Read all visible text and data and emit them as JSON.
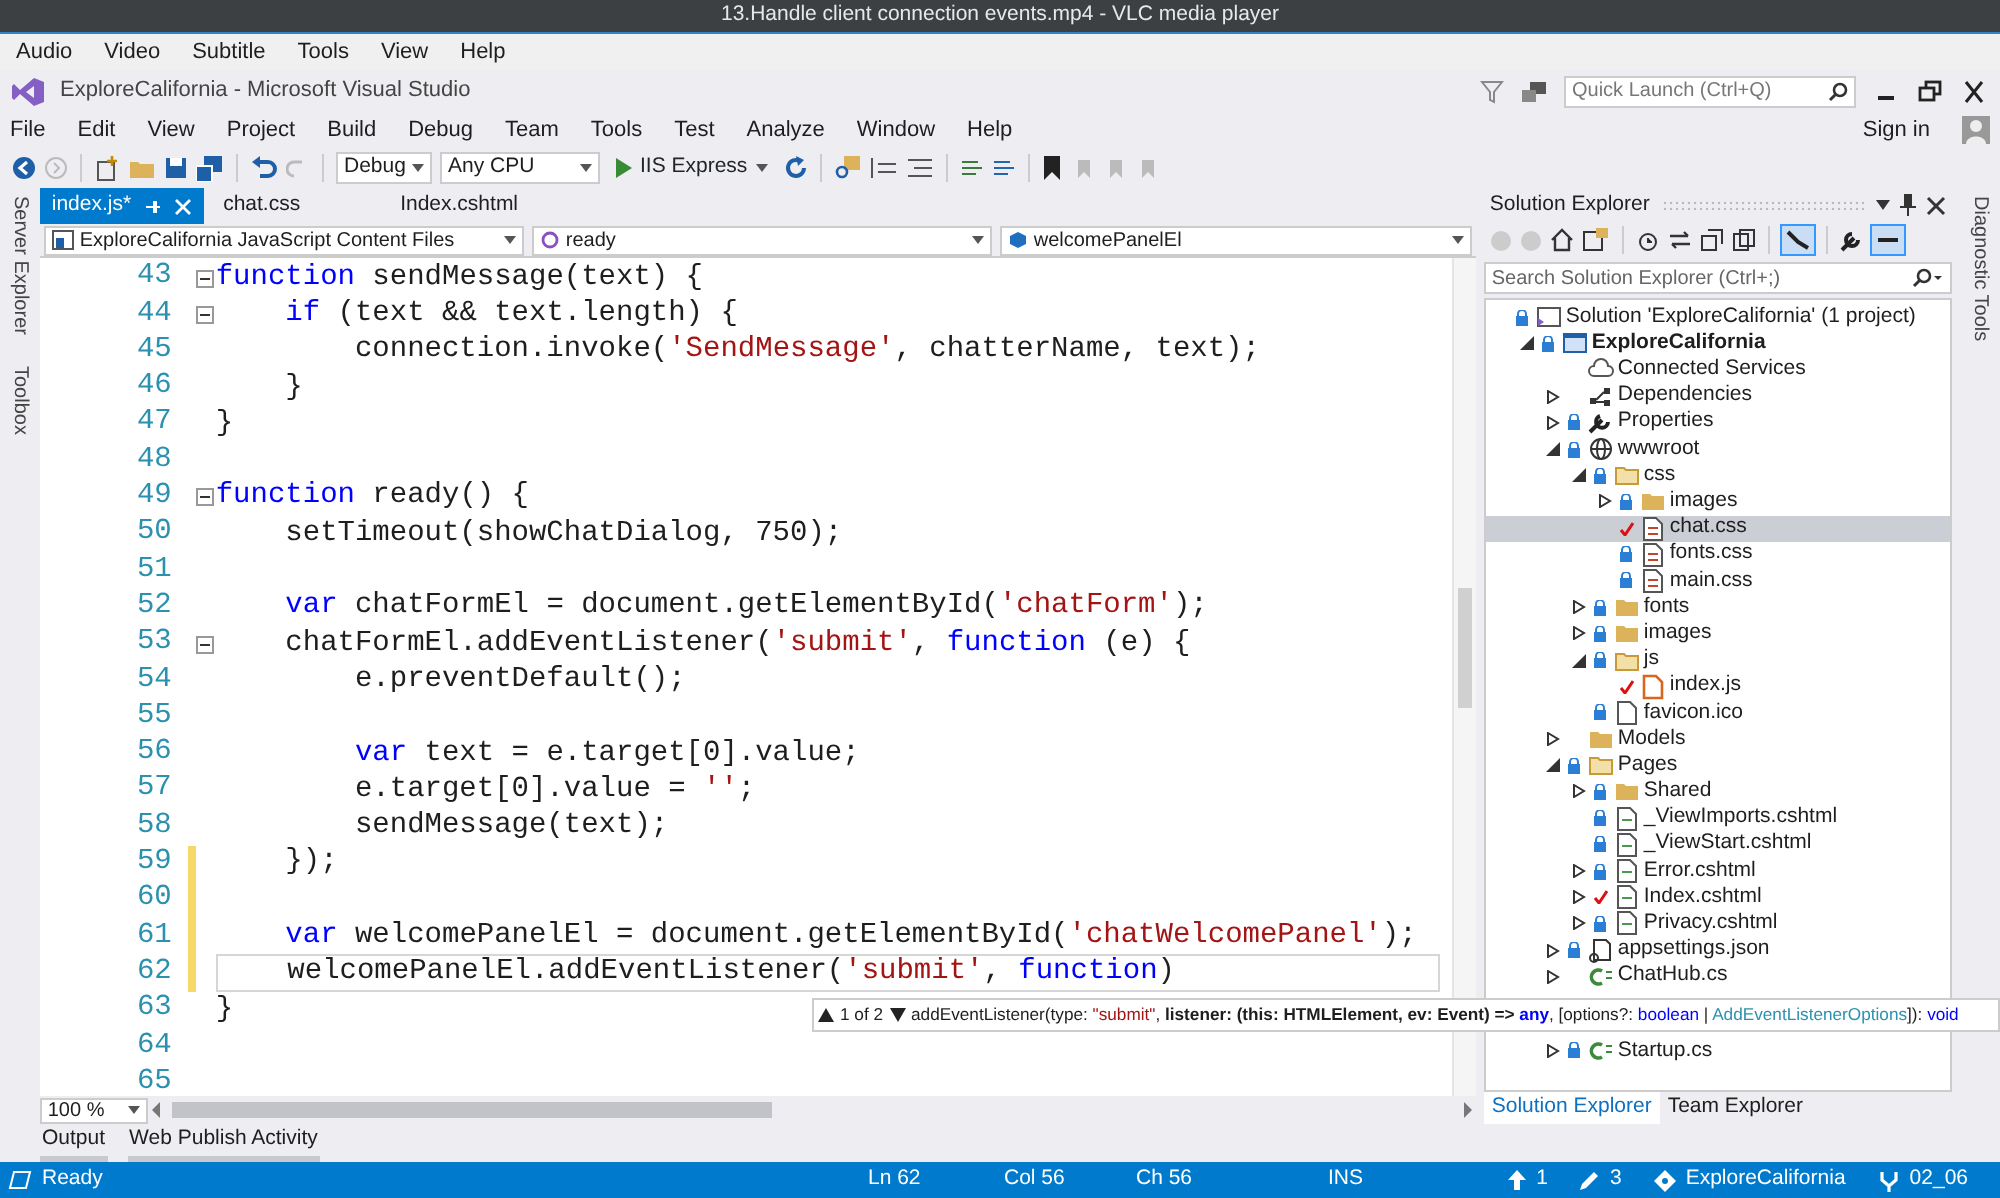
{
  "video_player": {
    "title": "13.Handle client connection events.mp4 - VLC media player",
    "menu": [
      "Audio",
      "Video",
      "Subtitle",
      "Tools",
      "View",
      "Help"
    ]
  },
  "ide": {
    "title": "ExploreCalifornia - Microsoft Visual Studio",
    "quick_launch": {
      "placeholder": "Quick Launch (Ctrl+Q)"
    },
    "menu": [
      "File",
      "Edit",
      "View",
      "Project",
      "Build",
      "Debug",
      "Team",
      "Tools",
      "Test",
      "Analyze",
      "Window",
      "Help"
    ],
    "sign_in": "Sign in",
    "toolbar": {
      "configuration": "Debug",
      "platform": "Any CPU",
      "run": "IIS Express"
    },
    "left_panels": [
      "Server Explorer",
      "Toolbox"
    ],
    "right_panels": [
      "Diagnostic Tools"
    ]
  },
  "editor": {
    "tabs": [
      {
        "label": "index.js*",
        "selected": true
      },
      {
        "label": "chat.css",
        "selected": false
      },
      {
        "label": "Index.cshtml",
        "selected": false
      }
    ],
    "navigation": [
      "ExploreCalifornia JavaScript Content Files",
      "ready",
      "welcomePanelEl"
    ],
    "lines": [
      {
        "number": "43",
        "collapsible": true,
        "changed": false,
        "current": false,
        "tokens": [
          {
            "kind": "keyword",
            "text": "function"
          },
          {
            "kind": "plain",
            "text": " sendMessage(text) {"
          }
        ]
      },
      {
        "number": "44",
        "collapsible": true,
        "changed": false,
        "current": false,
        "tokens": [
          {
            "kind": "keyword",
            "text": "    if"
          },
          {
            "kind": "plain",
            "text": " (text && text.length) {"
          }
        ]
      },
      {
        "number": "45",
        "collapsible": false,
        "changed": false,
        "current": false,
        "tokens": [
          {
            "kind": "plain",
            "text": "        connection.invoke("
          },
          {
            "kind": "string",
            "text": "'SendMessage'"
          },
          {
            "kind": "plain",
            "text": ", chatterName, text);"
          }
        ]
      },
      {
        "number": "46",
        "collapsible": false,
        "changed": false,
        "current": false,
        "tokens": [
          {
            "kind": "plain",
            "text": "    }"
          }
        ]
      },
      {
        "number": "47",
        "collapsible": false,
        "changed": false,
        "current": false,
        "tokens": [
          {
            "kind": "plain",
            "text": "}"
          }
        ]
      },
      {
        "number": "48",
        "collapsible": false,
        "changed": false,
        "current": false
      },
      {
        "number": "49",
        "collapsible": true,
        "changed": false,
        "current": false,
        "tokens": [
          {
            "kind": "keyword",
            "text": "function"
          },
          {
            "kind": "plain",
            "text": " ready() {"
          }
        ]
      },
      {
        "number": "50",
        "collapsible": false,
        "changed": false,
        "current": false,
        "tokens": [
          {
            "kind": "plain",
            "text": "    setTimeout(showChatDialog, 750);"
          }
        ]
      },
      {
        "number": "51",
        "collapsible": false,
        "changed": false,
        "current": false
      },
      {
        "number": "52",
        "collapsible": false,
        "changed": false,
        "current": false,
        "tokens": [
          {
            "kind": "keyword",
            "text": "    var"
          },
          {
            "kind": "plain",
            "text": " chatFormEl = document.getElementById("
          },
          {
            "kind": "string",
            "text": "'chatForm'"
          },
          {
            "kind": "plain",
            "text": ");"
          }
        ]
      },
      {
        "number": "53",
        "collapsible": true,
        "changed": false,
        "current": false,
        "tokens": [
          {
            "kind": "plain",
            "text": "    chatFormEl.addEventListener("
          },
          {
            "kind": "string",
            "text": "'submit'"
          },
          {
            "kind": "plain",
            "text": ", "
          },
          {
            "kind": "keyword",
            "text": "function"
          },
          {
            "kind": "plain",
            "text": " (e) {"
          }
        ]
      },
      {
        "number": "54",
        "collapsible": false,
        "changed": false,
        "current": false,
        "tokens": [
          {
            "kind": "plain",
            "text": "        e.preventDefault();"
          }
        ]
      },
      {
        "number": "55",
        "collapsible": false,
        "changed": false,
        "current": false
      },
      {
        "number": "56",
        "collapsible": false,
        "changed": false,
        "current": false,
        "tokens": [
          {
            "kind": "keyword",
            "text": "        var"
          },
          {
            "kind": "plain",
            "text": " text = e.target[0].value;"
          }
        ]
      },
      {
        "number": "57",
        "collapsible": false,
        "changed": false,
        "current": false,
        "tokens": [
          {
            "kind": "plain",
            "text": "        e.target[0].value = "
          },
          {
            "kind": "string",
            "text": "''"
          },
          {
            "kind": "plain",
            "text": ";"
          }
        ]
      },
      {
        "number": "58",
        "collapsible": false,
        "changed": false,
        "current": false,
        "tokens": [
          {
            "kind": "plain",
            "text": "        sendMessage(text);"
          }
        ]
      },
      {
        "number": "59",
        "collapsible": false,
        "changed": true,
        "current": false,
        "tokens": [
          {
            "kind": "plain",
            "text": "    });"
          }
        ]
      },
      {
        "number": "60",
        "collapsible": false,
        "changed": true,
        "current": false
      },
      {
        "number": "61",
        "collapsible": false,
        "changed": true,
        "current": false,
        "tokens": [
          {
            "kind": "keyword",
            "text": "    var"
          },
          {
            "kind": "plain",
            "text": " welcomePanelEl = document.getElementById("
          },
          {
            "kind": "string",
            "text": "'chatWelcomePanel'"
          },
          {
            "kind": "plain",
            "text": ");"
          }
        ]
      },
      {
        "number": "62",
        "collapsible": false,
        "changed": true,
        "current": true,
        "tokens": [
          {
            "kind": "plain",
            "text": "    welcomePanelEl.addEventListener("
          },
          {
            "kind": "string",
            "text": "'submit'"
          },
          {
            "kind": "plain",
            "text": ", "
          },
          {
            "kind": "keyword",
            "text": "function"
          },
          {
            "kind": "plain",
            "text": ")"
          }
        ]
      },
      {
        "number": "63",
        "collapsible": false,
        "changed": false,
        "current": false,
        "tokens": [
          {
            "kind": "plain",
            "text": "}"
          }
        ]
      },
      {
        "number": "64",
        "collapsible": false,
        "changed": false,
        "current": false
      },
      {
        "number": "65",
        "collapsible": false,
        "changed": false,
        "current": false
      }
    ],
    "zoom": "100 %",
    "tooltip": {
      "counter": "1 of 2",
      "segments": [
        {
          "kind": "plain",
          "text": "addEventListener(type: "
        },
        {
          "kind": "string",
          "text": "\"submit\""
        },
        {
          "kind": "plain",
          "text": ", "
        },
        {
          "kind": "bold",
          "text": "listener: (this: HTMLElement, ev: Event) => "
        },
        {
          "kind": "keyword",
          "text": "any"
        },
        {
          "kind": "plain",
          "text": ", [options?: "
        },
        {
          "kind": "keyword",
          "text": "boolean"
        },
        {
          "kind": "plain",
          "text": " | "
        },
        {
          "kind": "type",
          "text": "AddEventListenerOptions"
        },
        {
          "kind": "plain",
          "text": "]): "
        },
        {
          "kind": "keyword",
          "text": "void"
        }
      ]
    }
  },
  "solution_explorer": {
    "title": "Solution Explorer",
    "search": {
      "placeholder": "Search Solution Explorer (Ctrl+;)"
    },
    "tree": [
      {
        "label": "Solution 'ExploreCalifornia' (1 project)",
        "kind": "solution",
        "locked": true,
        "modified": false,
        "selected": false,
        "children": [
          {
            "label": "ExploreCalifornia",
            "kind": "project",
            "locked": true,
            "modified": false,
            "expanded": true,
            "selected": false,
            "children": [
              {
                "label": "Connected Services",
                "kind": "service",
                "locked": false,
                "modified": false,
                "selected": false
              },
              {
                "label": "Dependencies",
                "kind": "dependencies",
                "locked": false,
                "modified": false,
                "expanded": false,
                "selected": false
              },
              {
                "label": "Properties",
                "kind": "properties",
                "locked": true,
                "modified": false,
                "expanded": false,
                "selected": false
              },
              {
                "label": "wwwroot",
                "kind": "web-root",
                "locked": true,
                "modified": false,
                "expanded": true,
                "selected": false,
                "children": [
                  {
                    "label": "css",
                    "kind": "folder",
                    "locked": true,
                    "modified": false,
                    "expanded": true,
                    "selected": false,
                    "children": [
                      {
                        "label": "images",
                        "kind": "folder",
                        "locked": true,
                        "modified": false,
                        "expanded": false,
                        "selected": false
                      },
                      {
                        "label": "chat.css",
                        "kind": "stylesheet",
                        "locked": false,
                        "modified": true,
                        "selected": true
                      },
                      {
                        "label": "fonts.css",
                        "kind": "stylesheet",
                        "locked": true,
                        "modified": false,
                        "selected": false
                      },
                      {
                        "label": "main.css",
                        "kind": "stylesheet",
                        "locked": true,
                        "modified": false,
                        "selected": false
                      }
                    ]
                  },
                  {
                    "label": "fonts",
                    "kind": "folder",
                    "locked": true,
                    "modified": false,
                    "expanded": false,
                    "selected": false
                  },
                  {
                    "label": "images",
                    "kind": "folder",
                    "locked": true,
                    "modified": false,
                    "expanded": false,
                    "selected": false
                  },
                  {
                    "label": "js",
                    "kind": "folder",
                    "locked": true,
                    "modified": false,
                    "expanded": true,
                    "selected": false,
                    "children": [
                      {
                        "label": "index.js",
                        "kind": "script",
                        "locked": false,
                        "modified": true,
                        "selected": false
                      }
                    ]
                  },
                  {
                    "label": "favicon.ico",
                    "kind": "file",
                    "locked": true,
                    "modified": false,
                    "selected": false
                  }
                ]
              },
              {
                "label": "Models",
                "kind": "folder",
                "locked": false,
                "modified": false,
                "expanded": false,
                "selected": false
              },
              {
                "label": "Pages",
                "kind": "folder",
                "locked": true,
                "modified": false,
                "expanded": true,
                "selected": false,
                "children": [
                  {
                    "label": "Shared",
                    "kind": "folder",
                    "locked": true,
                    "modified": false,
                    "expanded": false,
                    "selected": false
                  },
                  {
                    "label": "_ViewImports.cshtml",
                    "kind": "page",
                    "locked": true,
                    "modified": false,
                    "selected": false
                  },
                  {
                    "label": "_ViewStart.cshtml",
                    "kind": "page",
                    "locked": true,
                    "modified": false,
                    "selected": false
                  },
                  {
                    "label": "Error.cshtml",
                    "kind": "page",
                    "locked": true,
                    "modified": false,
                    "expanded": false,
                    "selected": false
                  },
                  {
                    "label": "Index.cshtml",
                    "kind": "page",
                    "locked": false,
                    "modified": true,
                    "expanded": false,
                    "selected": false
                  },
                  {
                    "label": "Privacy.cshtml",
                    "kind": "page",
                    "locked": true,
                    "modified": false,
                    "expanded": false,
                    "selected": false
                  }
                ]
              },
              {
                "label": "appsettings.json",
                "kind": "json",
                "locked": true,
                "modified": false,
                "expanded": false,
                "selected": false
              },
              {
                "label": "ChatHub.cs",
                "kind": "csharp",
                "locked": false,
                "modified": false,
                "expanded": false,
                "selected": false
              },
              {
                "label": "Startup.cs",
                "kind": "csharp",
                "locked": true,
                "modified": false,
                "expanded": false,
                "selected": false
              }
            ]
          }
        ]
      }
    ],
    "tabs": [
      {
        "label": "Solution Explorer",
        "selected": true
      },
      {
        "label": "Team Explorer",
        "selected": false
      }
    ]
  },
  "bottom_tabs": [
    "Output",
    "Web Publish Activity"
  ],
  "status_bar": {
    "state": "Ready",
    "line": "Ln 62",
    "column": "Col 56",
    "char": "Ch 56",
    "mode": "INS",
    "unpushed": "1",
    "changes": "3",
    "repository": "ExploreCalifornia",
    "branch": "02_06"
  }
}
